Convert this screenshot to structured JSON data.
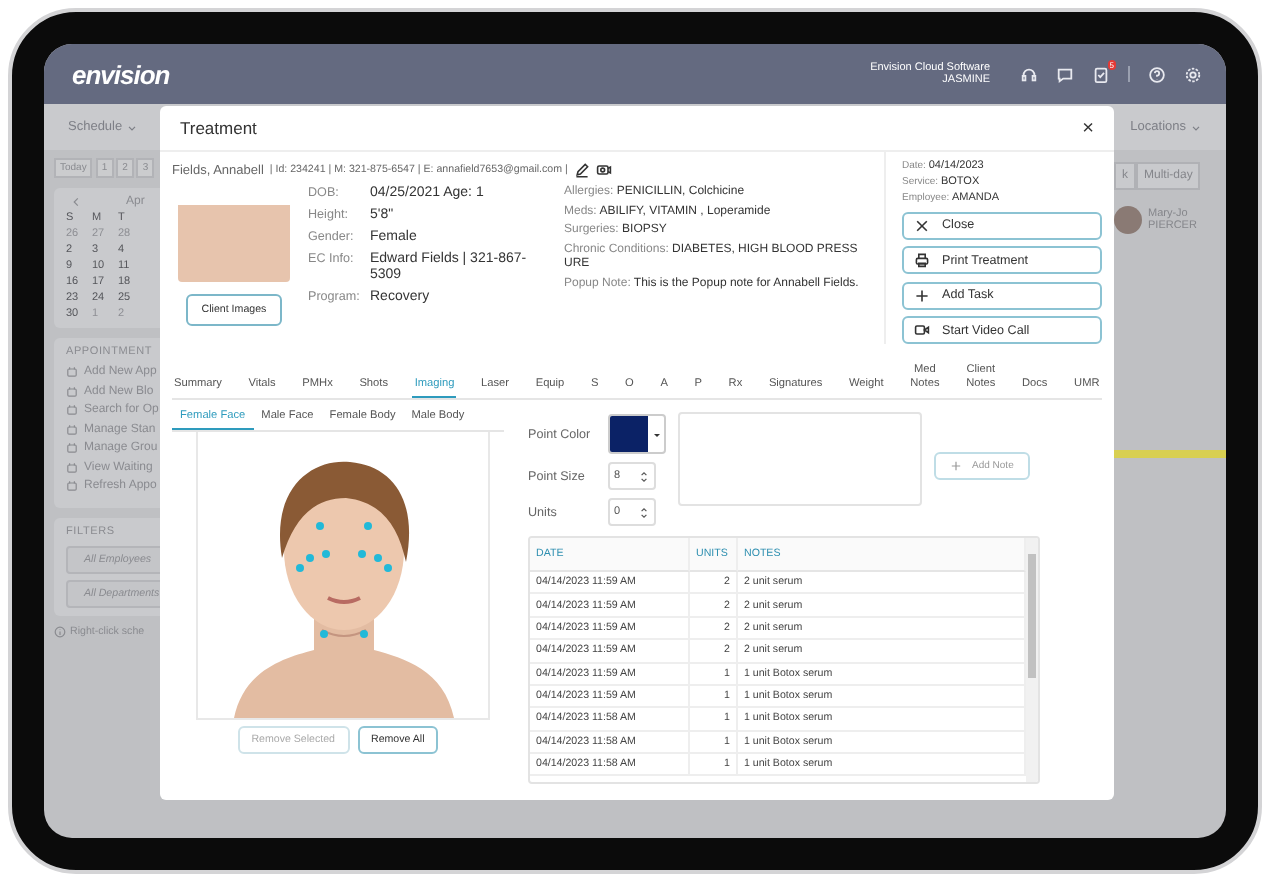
{
  "header": {
    "logo": "envision",
    "company": "Envision Cloud Software",
    "user": "JASMINE",
    "notification_count": "5"
  },
  "toolbar": {
    "left": "Schedule",
    "right": "Locations"
  },
  "date_nav": [
    "Today",
    "1",
    "2",
    "3"
  ],
  "calendar": {
    "month": "Apr",
    "weekdays": [
      "S",
      "M",
      "T"
    ],
    "weeks": [
      [
        {
          "day": "26",
          "other_month": true
        },
        {
          "day": "27",
          "other_month": true
        },
        {
          "day": "28",
          "other_month": true
        }
      ],
      [
        {
          "day": "2",
          "other_month": false
        },
        {
          "day": "3",
          "other_month": false
        },
        {
          "day": "4",
          "other_month": false
        }
      ],
      [
        {
          "day": "9",
          "other_month": false
        },
        {
          "day": "10",
          "other_month": false
        },
        {
          "day": "11",
          "other_month": false
        }
      ],
      [
        {
          "day": "16",
          "other_month": false
        },
        {
          "day": "17",
          "other_month": false
        },
        {
          "day": "18",
          "other_month": false
        }
      ],
      [
        {
          "day": "23",
          "other_month": false
        },
        {
          "day": "24",
          "other_month": false
        },
        {
          "day": "25",
          "other_month": false
        }
      ],
      [
        {
          "day": "30",
          "other_month": false
        },
        {
          "day": "1",
          "other_month": true
        },
        {
          "day": "2",
          "other_month": true
        }
      ]
    ]
  },
  "appointment_panel": {
    "title": "APPOINTMENT",
    "items": [
      "Add New App",
      "Add New Blo",
      "Search for Op",
      "Manage Stan",
      "Manage Grou",
      "View Waiting",
      "Refresh Appo"
    ]
  },
  "filters": {
    "title": "FILTERS",
    "fields": [
      "All Employees",
      "All Departments"
    ]
  },
  "hint": "Right-click sche",
  "view_buttons": [
    "k",
    "Multi-day"
  ],
  "staff": {
    "name": "Mary-Jo",
    "role": "PIERCER"
  },
  "modal": {
    "title": "Treatment",
    "close": "×",
    "patient": {
      "name": "Fields, Annabell",
      "details": "| Id: 234241 | M: 321-875-6547 | E: annafield7653@gmail.com |"
    },
    "client_images_button": "Client Images",
    "demographics": [
      {
        "label": "DOB:",
        "value": "04/25/2021 Age: 1"
      },
      {
        "label": "Height:",
        "value": "5'8\""
      },
      {
        "label": "Gender:",
        "value": "Female"
      },
      {
        "label": "EC Info:",
        "value": "Edward Fields | 321-867-5309"
      },
      {
        "label": "Program:",
        "value": "Recovery"
      }
    ],
    "medical": [
      {
        "label": "Allergies:",
        "value": "PENICILLIN, Colchicine"
      },
      {
        "label": "Meds:",
        "value": "ABILIFY, VITAMIN , Loperamide"
      },
      {
        "label": "Surgeries:",
        "value": "BIOPSY"
      },
      {
        "label": "Chronic Conditions:",
        "value": "DIABETES, HIGH BLOOD PRESSURE"
      },
      {
        "label": "Popup Note:",
        "value": "This is the Popup note for Annabell Fields."
      }
    ],
    "visit": [
      {
        "label": "Date:",
        "value": "04/14/2023"
      },
      {
        "label": "Service:",
        "value": "BOTOX"
      },
      {
        "label": "Employee:",
        "value": "AMANDA"
      }
    ],
    "actions": [
      "Close",
      "Print Treatment",
      "Add Task",
      "Start Video Call"
    ],
    "tabs": [
      {
        "label": "Summary",
        "selected": false
      },
      {
        "label": "Vitals",
        "selected": false
      },
      {
        "label": "PMHx",
        "selected": false
      },
      {
        "label": "Shots",
        "selected": false
      },
      {
        "label": "Imaging",
        "selected": true
      },
      {
        "label": "Laser",
        "selected": false
      },
      {
        "label": "Equip",
        "selected": false
      },
      {
        "label": "S",
        "selected": false
      },
      {
        "label": "O",
        "selected": false
      },
      {
        "label": "A",
        "selected": false
      },
      {
        "label": "P",
        "selected": false
      },
      {
        "label": "Rx",
        "selected": false
      },
      {
        "label": "Signatures",
        "selected": false
      },
      {
        "label": "Weight",
        "selected": false
      },
      {
        "label": "Med Notes",
        "selected": false
      },
      {
        "label": "Client Notes",
        "selected": false
      },
      {
        "label": "Docs",
        "selected": false
      },
      {
        "label": "UMR",
        "selected": false
      }
    ],
    "image_tabs": [
      {
        "label": "Female Face",
        "selected": true
      },
      {
        "label": "Male Face",
        "selected": false
      },
      {
        "label": "Female Body",
        "selected": false
      },
      {
        "label": "Male Body",
        "selected": false
      }
    ],
    "point_color": {
      "label": "Point Color",
      "color": "#0b2266"
    },
    "point_size": {
      "label": "Point Size",
      "value": "8"
    },
    "units": {
      "label": "Units",
      "value": "0"
    },
    "add_note_button": "Add Note",
    "remove_buttons": [
      {
        "label": "Remove Selected",
        "disabled": true
      },
      {
        "label": "Remove All",
        "disabled": false
      }
    ],
    "table": {
      "columns": [
        "DATE",
        "UNITS",
        "NOTES"
      ],
      "rows": [
        [
          "04/14/2023 11:59 AM",
          "2",
          "2 unit serum"
        ],
        [
          "04/14/2023 11:59 AM",
          "2",
          "2 unit serum"
        ],
        [
          "04/14/2023 11:59 AM",
          "2",
          "2 unit serum"
        ],
        [
          "04/14/2023 11:59 AM",
          "2",
          "2 unit serum"
        ],
        [
          "04/14/2023 11:59 AM",
          "1",
          "1 unit Botox serum"
        ],
        [
          "04/14/2023 11:59 AM",
          "1",
          "1 unit Botox serum"
        ],
        [
          "04/14/2023 11:58 AM",
          "1",
          "1 unit Botox serum"
        ],
        [
          "04/14/2023 11:58 AM",
          "1",
          "1 unit Botox serum"
        ],
        [
          "04/14/2023 11:58 AM",
          "1",
          "1 unit Botox serum"
        ]
      ]
    }
  }
}
